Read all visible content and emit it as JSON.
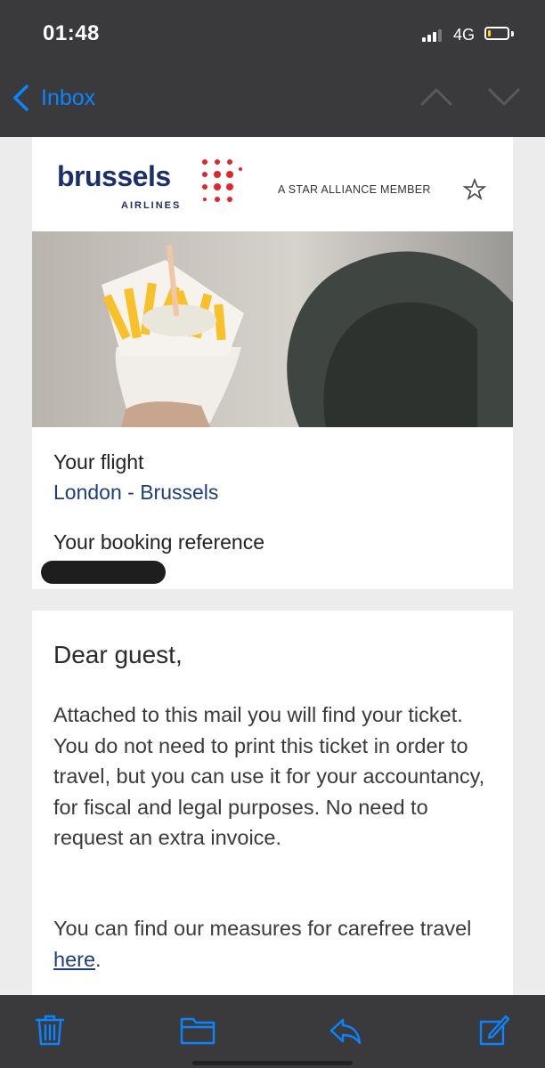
{
  "status_bar": {
    "time": "01:48",
    "network": "4G",
    "signal_icon": "signal-bars-icon",
    "battery_icon": "battery-low-icon",
    "battery_level_fraction": 0.1
  },
  "nav": {
    "back_label": "Inbox",
    "back_icon": "chevron-left-icon",
    "prev_icon": "chevron-up-icon",
    "next_icon": "chevron-down-icon"
  },
  "email": {
    "logo": {
      "word": "brussels",
      "sub": "AIRLINES"
    },
    "alliance_label": "A STAR ALLIANCE MEMBER",
    "flight_label": "Your flight",
    "flight_route": "London - Brussels",
    "booking_label": "Your booking reference",
    "greeting": "Dear guest,",
    "paragraph1": "Attached to this mail you will find your ticket. You do not need to print this ticket in order to travel, but you can use it for your accountancy, for fiscal and legal purposes. No need to request an extra invoice.",
    "paragraph2_prefix": "You can find our measures for carefree travel ",
    "paragraph2_link": "here",
    "paragraph2_suffix": "."
  },
  "toolbar": {
    "trash_icon": "trash-icon",
    "folder_icon": "folder-icon",
    "reply_icon": "reply-icon",
    "compose_icon": "compose-icon"
  },
  "colors": {
    "accent": "#0a84ff",
    "brand_navy": "#1b2f6b",
    "brand_red": "#e3242b",
    "chrome": "#3a3a3c"
  }
}
